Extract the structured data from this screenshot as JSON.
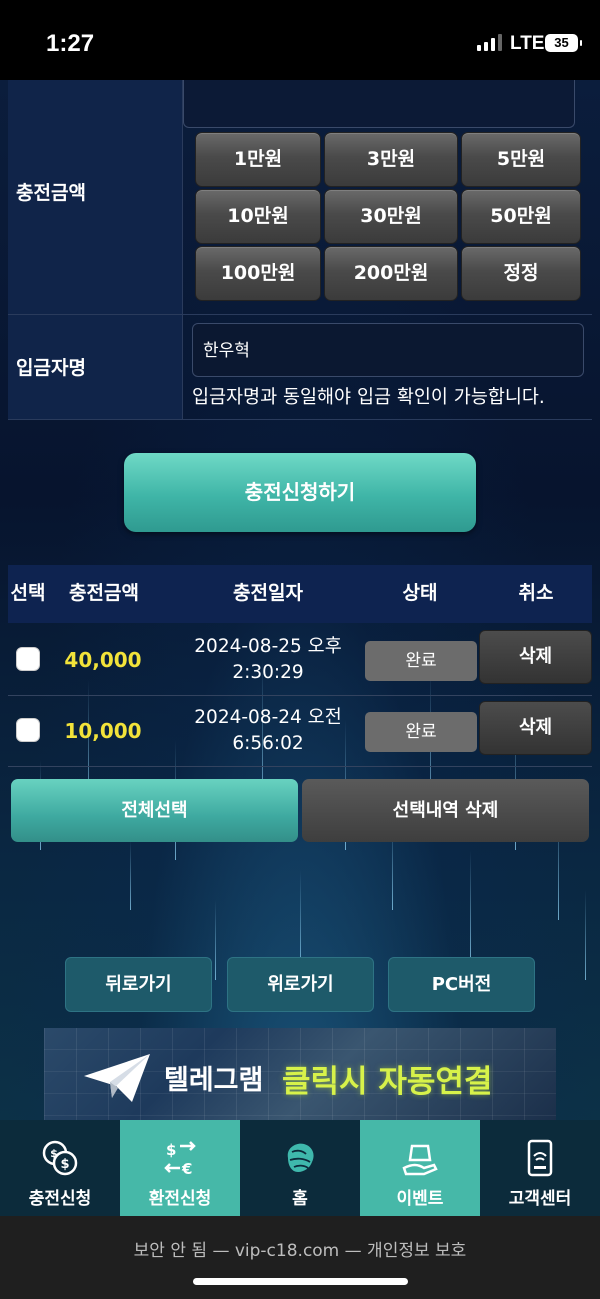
{
  "status_bar": {
    "time": "1:27",
    "network": "LTE",
    "battery": "35"
  },
  "charge_form": {
    "amount_label": "충전금액",
    "amount_buttons": [
      "1만원",
      "3만원",
      "5만원",
      "10만원",
      "30만원",
      "50만원",
      "100만원",
      "200만원",
      "정정"
    ],
    "depositor_label": "입금자명",
    "depositor_value": "한우혁",
    "depositor_note": "입금자명과 동일해야 입금 확인이 가능합니다.",
    "submit_label": "충전신청하기"
  },
  "history_table": {
    "headers": [
      "선택",
      "충전금액",
      "충전일자",
      "상태",
      "취소"
    ],
    "rows": [
      {
        "amount": "40,000",
        "date_line1": "2024-08-25 오후",
        "date_line2": "2:30:29",
        "status": "완료",
        "action": "삭제"
      },
      {
        "amount": "10,000",
        "date_line1": "2024-08-24 오전",
        "date_line2": "6:56:02",
        "status": "완료",
        "action": "삭제"
      }
    ],
    "select_all_label": "전체선택",
    "delete_selected_label": "선택내역 삭제"
  },
  "nav_buttons": [
    "뒤로가기",
    "위로가기",
    "PC버전"
  ],
  "telegram_banner": {
    "text_white": "텔레그램",
    "text_highlight": "클릭시 자동연결"
  },
  "tab_bar": {
    "items": [
      {
        "label": "충전신청",
        "icon": "coins-icon",
        "active": false
      },
      {
        "label": "환전신청",
        "icon": "currency-exchange-icon",
        "active": true
      },
      {
        "label": "홈",
        "icon": "brain-logo-icon",
        "active": false
      },
      {
        "label": "이벤트",
        "icon": "gift-hand-icon",
        "active": true
      },
      {
        "label": "고객센터",
        "icon": "phone-support-icon",
        "active": false
      }
    ]
  },
  "browser": {
    "url_text": "보안 안 됨 — vip-c18.com — 개인정보 보호"
  },
  "colors": {
    "accent_teal": "#46b8a8",
    "amount_yellow": "#f2e33a",
    "banner_highlight": "#d7f24a",
    "panel_navy": "#102449"
  }
}
